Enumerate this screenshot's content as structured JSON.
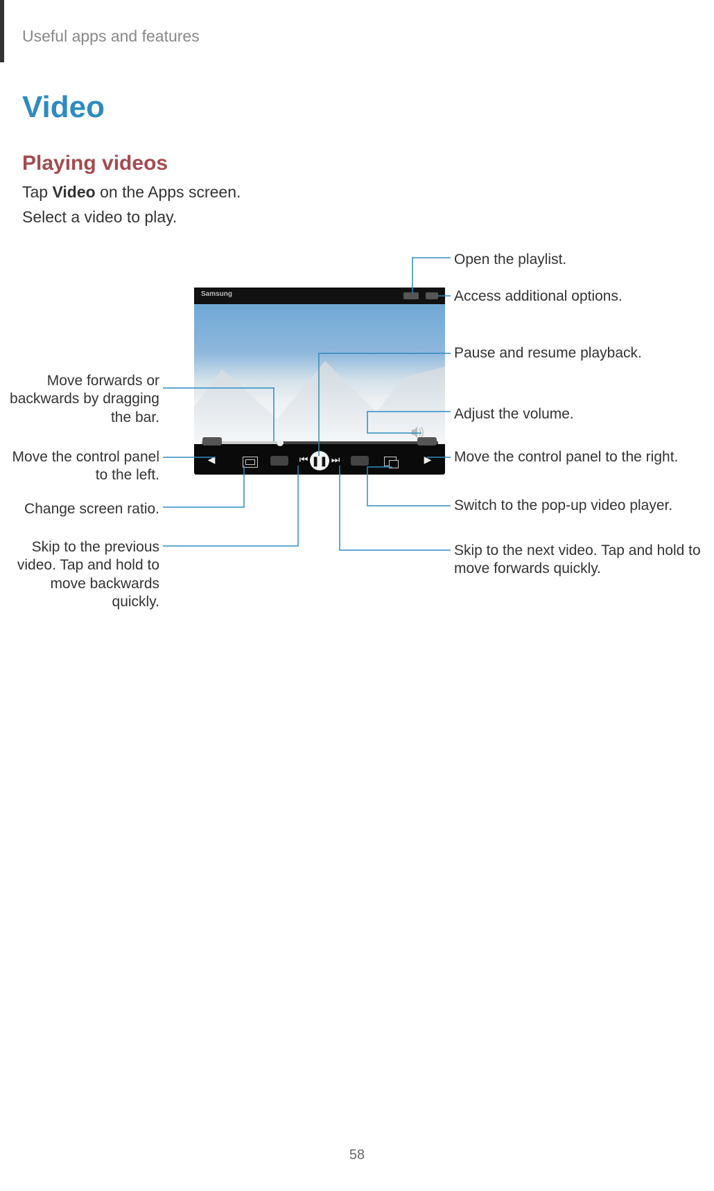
{
  "header": "Useful apps and features",
  "h1": "Video",
  "h2": "Playing videos",
  "body1_pre": "Tap ",
  "body1_bold": "Video",
  "body1_post": " on the Apps screen.",
  "body2": "Select a video to play.",
  "panel_title": "Samsung",
  "pause_glyph": "❚❚",
  "prev_glyph": "⏮",
  "next_glyph": "⏭",
  "left_arrow": "◀",
  "right_arrow": "▶",
  "labels": {
    "move_seek": "Move forwards or backwards by dragging the bar.",
    "move_left": "Move the control panel to the left.",
    "ratio": "Change screen ratio.",
    "prev": "Skip to the previous video. Tap and hold to move backwards quickly.",
    "playlist": "Open the playlist.",
    "more": "Access additional options.",
    "pause": "Pause and resume playback.",
    "volume": "Adjust the volume.",
    "move_right": "Move the control panel to the right.",
    "popup": "Switch to the pop-up video player.",
    "next": "Skip to the next video. Tap and hold to move forwards quickly."
  },
  "page_num": "58"
}
